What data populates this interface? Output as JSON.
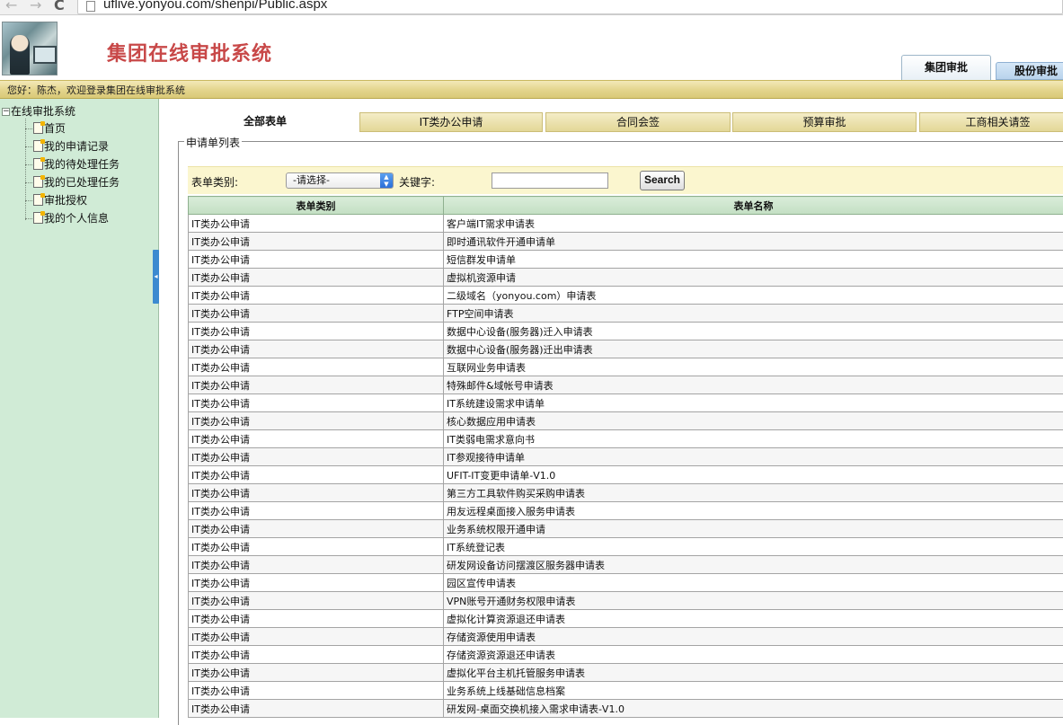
{
  "browser": {
    "back": "←",
    "forward": "→",
    "reload": "C",
    "url": "uflive.yonyou.com/shenpi/Public.aspx"
  },
  "header": {
    "title": "集团在线审批系统",
    "tabs": [
      {
        "label": "集团审批"
      },
      {
        "label": "股份审批"
      }
    ]
  },
  "welcome": "您好：陈杰，欢迎登录集团在线审批系统",
  "sidebar": {
    "root": "在线审批系统",
    "root_toggle": "−",
    "items": [
      {
        "label": "首页"
      },
      {
        "label": "我的申请记录"
      },
      {
        "label": "我的待处理任务"
      },
      {
        "label": "我的已处理任务"
      },
      {
        "label": "审批授权"
      },
      {
        "label": "我的个人信息"
      }
    ],
    "collapse": "◂"
  },
  "tabs": [
    {
      "label": "全部表单"
    },
    {
      "label": "IT类办公申请"
    },
    {
      "label": "合同会签"
    },
    {
      "label": "预算审批"
    },
    {
      "label": "工商相关请签"
    }
  ],
  "fieldset_legend": "申请单列表",
  "search": {
    "category_label": "表单类别:",
    "category_value": "-请选择-",
    "keyword_label": "关键字:",
    "keyword_value": "",
    "button": "Search"
  },
  "table": {
    "headers": [
      "表单类别",
      "表单名称"
    ],
    "rows": [
      [
        "IT类办公申请",
        "客户端IT需求申请表"
      ],
      [
        "IT类办公申请",
        "即时通讯软件开通申请单"
      ],
      [
        "IT类办公申请",
        "短信群发申请单"
      ],
      [
        "IT类办公申请",
        "虚拟机资源申请"
      ],
      [
        "IT类办公申请",
        "二级域名（yonyou.com）申请表"
      ],
      [
        "IT类办公申请",
        "FTP空间申请表"
      ],
      [
        "IT类办公申请",
        "数据中心设备(服务器)迁入申请表"
      ],
      [
        "IT类办公申请",
        "数据中心设备(服务器)迁出申请表"
      ],
      [
        "IT类办公申请",
        "互联网业务申请表"
      ],
      [
        "IT类办公申请",
        "特殊邮件&域帐号申请表"
      ],
      [
        "IT类办公申请",
        "IT系统建设需求申请单"
      ],
      [
        "IT类办公申请",
        "核心数据应用申请表"
      ],
      [
        "IT类办公申请",
        "IT类弱电需求意向书"
      ],
      [
        "IT类办公申请",
        "IT参观接待申请单"
      ],
      [
        "IT类办公申请",
        "UFIT-IT变更申请单-V1.0"
      ],
      [
        "IT类办公申请",
        "第三方工具软件购买采购申请表"
      ],
      [
        "IT类办公申请",
        "用友远程桌面接入服务申请表"
      ],
      [
        "IT类办公申请",
        "业务系统权限开通申请"
      ],
      [
        "IT类办公申请",
        "IT系统登记表"
      ],
      [
        "IT类办公申请",
        "研发网设备访问摆渡区服务器申请表"
      ],
      [
        "IT类办公申请",
        "园区宣传申请表"
      ],
      [
        "IT类办公申请",
        "VPN账号开通财务权限申请表"
      ],
      [
        "IT类办公申请",
        "虚拟化计算资源退还申请表"
      ],
      [
        "IT类办公申请",
        "存储资源使用申请表"
      ],
      [
        "IT类办公申请",
        "存储资源资源退还申请表"
      ],
      [
        "IT类办公申请",
        "虚拟化平台主机托管服务申请表"
      ],
      [
        "IT类办公申请",
        "业务系统上线基础信息档案"
      ],
      [
        "IT类办公申请",
        "研发网-桌面交换机接入需求申请表-V1.0"
      ]
    ]
  },
  "colors": {
    "title": "#c84848",
    "sidebar_bg": "#d0ebd6",
    "welcome_strip": "#e3d48c",
    "tab_inactive": "#e3d797",
    "search_bar_bg": "#fbf6cf",
    "table_header": "#c3dfc3",
    "collapse_handle": "#3c8ad0"
  },
  "icons": {
    "tree_item": "document-icon",
    "select": "select-arrow-icon"
  }
}
